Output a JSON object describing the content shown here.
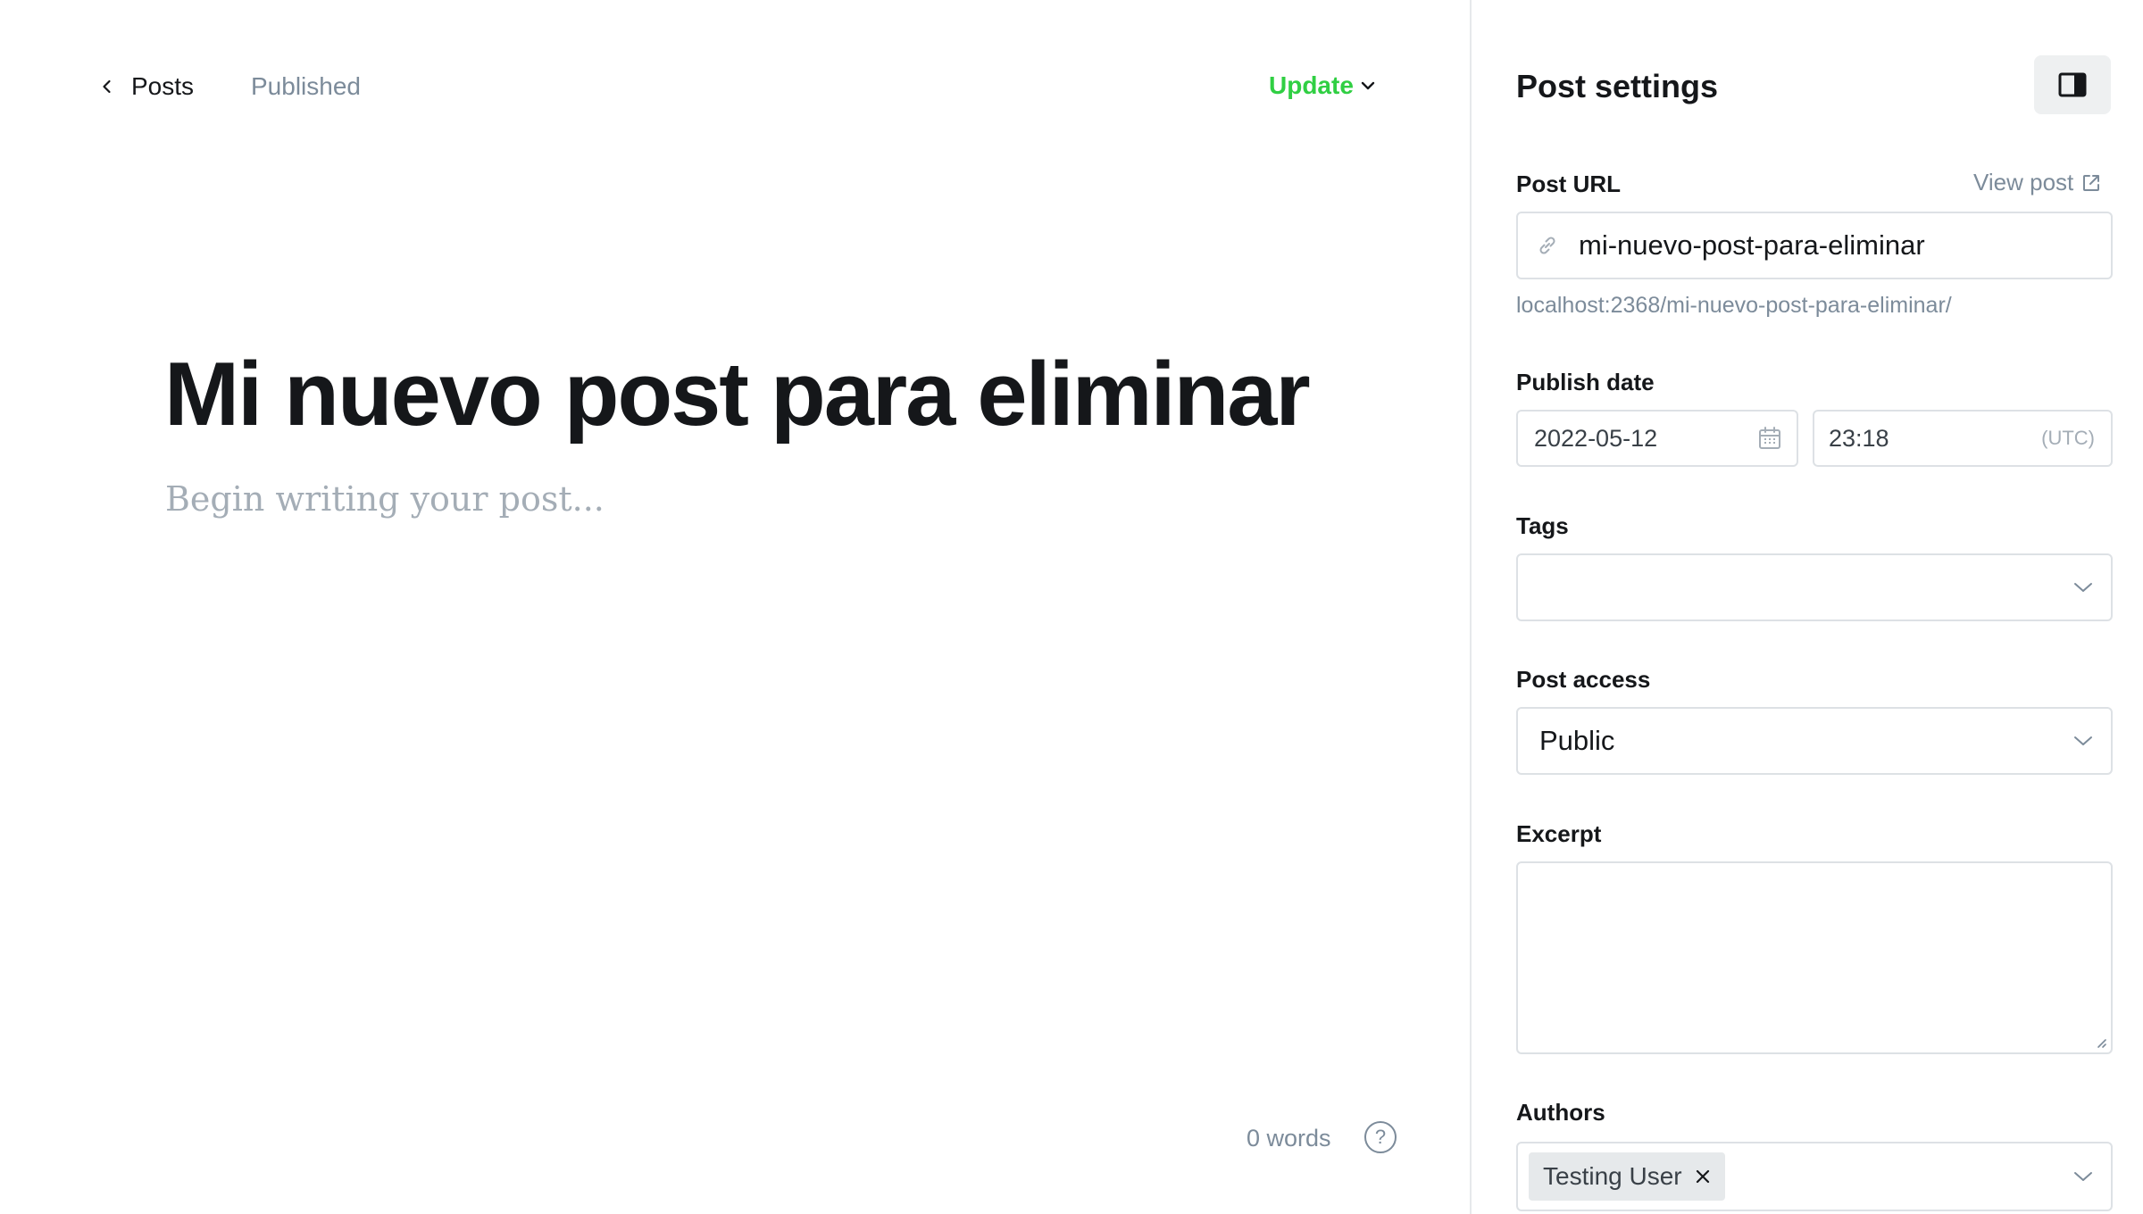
{
  "header": {
    "back_label": "Posts",
    "status": "Published",
    "update_label": "Update"
  },
  "post": {
    "title": "Mi nuevo post para eliminar",
    "body_placeholder": "Begin writing your post..."
  },
  "footer": {
    "word_count": "0 words",
    "help_glyph": "?"
  },
  "settings": {
    "title": "Post settings",
    "post_url": {
      "label": "Post URL",
      "view_post_label": "View post",
      "slug": "mi-nuevo-post-para-eliminar",
      "full_url": "localhost:2368/mi-nuevo-post-para-eliminar/"
    },
    "publish_date": {
      "label": "Publish date",
      "date": "2022-05-12",
      "time": "23:18",
      "timezone": "(UTC)"
    },
    "tags": {
      "label": "Tags",
      "value": ""
    },
    "post_access": {
      "label": "Post access",
      "value": "Public"
    },
    "excerpt": {
      "label": "Excerpt",
      "value": ""
    },
    "authors": {
      "label": "Authors",
      "items": [
        "Testing User"
      ]
    }
  },
  "colors": {
    "accent_green": "#30cf43",
    "muted_text": "#7c8b9a",
    "border": "#dde1e5"
  },
  "icons": [
    "chevron-left-icon",
    "chevron-down-icon",
    "help-icon",
    "sidebar-toggle-icon",
    "external-link-icon",
    "link-icon",
    "calendar-icon",
    "close-icon"
  ]
}
